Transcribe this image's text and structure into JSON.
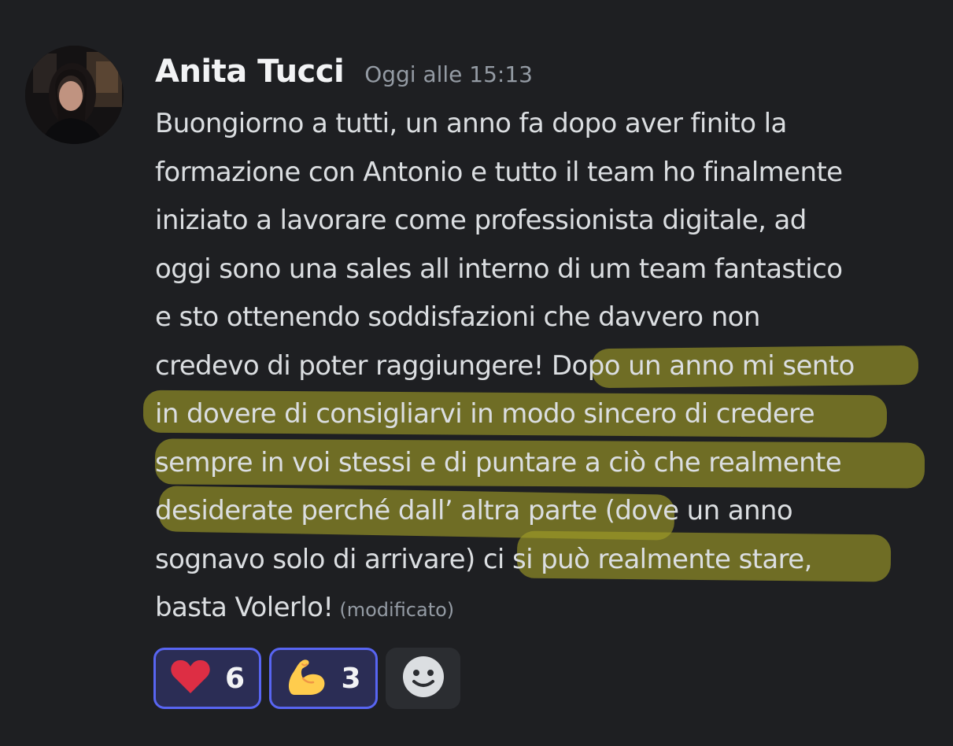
{
  "message": {
    "author": "Anita Tucci",
    "timestamp": "Oggi alle 15:13",
    "lines": [
      {
        "text": "Buongiorno a tutti, un anno fa dopo aver finito la"
      },
      {
        "text": "formazione con Antonio e tutto il team ho finalmente"
      },
      {
        "text": "iniziato a lavorare come professionista digitale, ad"
      },
      {
        "text": "oggi sono una sales all interno di um team fantastico"
      },
      {
        "text": "e sto ottenendo soddisfazioni che davvero non"
      },
      {
        "text": "credevo di poter raggiungere! Dopo un anno mi sento"
      },
      {
        "text": "in dovere di consigliarvi in modo sincero di credere"
      },
      {
        "text": "sempre in voi stessi e di puntare a ciò che realmente"
      },
      {
        "text": "desiderate perché dall’ altra parte (dove un anno"
      },
      {
        "text": "sognavo solo di arrivare) ci si può realmente stare,"
      },
      {
        "text": "basta Volerlo!"
      }
    ],
    "edited_label": "(modificato)"
  },
  "reactions": [
    {
      "emoji": "heart-icon",
      "count": "6",
      "active": true
    },
    {
      "emoji": "flexed-biceps-icon",
      "count": "3",
      "active": true
    }
  ],
  "add_reaction": {
    "icon": "add-reaction-icon"
  },
  "colors": {
    "background": "#1e1f22",
    "highlight": "#a29e26",
    "reaction_border": "#5865f2"
  }
}
